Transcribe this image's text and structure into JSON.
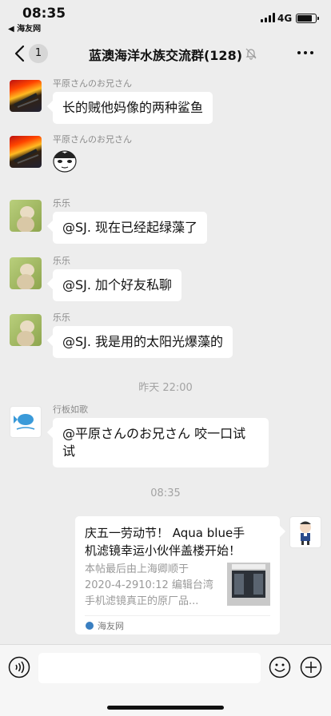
{
  "status_bar": {
    "time": "08:35",
    "back_app": "◀ 海友网",
    "network": "4G",
    "battery_level": 0.8
  },
  "nav": {
    "unread_count": "1",
    "title": "蓝澳海洋水族交流群(128)"
  },
  "messages": [
    {
      "sender": "平原さんのお兄さん",
      "text": "长的贼他妈像的两种鲨鱼"
    },
    {
      "sender": "平原さんのお兄さん",
      "sticker": "panda-face-sticker"
    },
    {
      "sender": "乐乐",
      "text": "@SJ. 现在已经起绿藻了"
    },
    {
      "sender": "乐乐",
      "text": "@SJ. 加个好友私聊"
    },
    {
      "sender": "乐乐",
      "text": "@SJ. 我是用的太阳光爆藻的"
    },
    {
      "sender": "行板如歌",
      "text_line1": "@平原さんのお兄さん 咬一口试",
      "text_line2": "试"
    }
  ],
  "timestamps": [
    "昨天 22:00",
    "08:35"
  ],
  "link_card": {
    "title_line1": "庆五一劳动节！ Aqua blue手",
    "title_line2": "机滤镜幸运小伙伴盖楼开始！",
    "desc_line1": "本帖最后由上海卿顺于",
    "desc_line2": "2020-4-2910:12 编辑台湾",
    "desc_line3": "手机滤镜真正的原厂品...",
    "source": "海友网"
  }
}
